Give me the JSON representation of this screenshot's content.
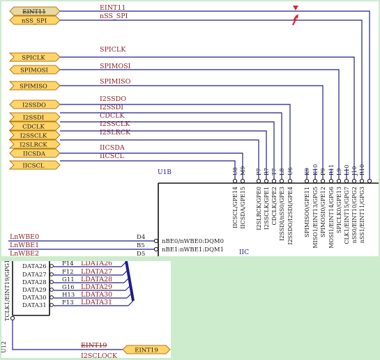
{
  "top_panel": {
    "ports": [
      {
        "label": "EINT11",
        "net": "EINT11",
        "highlighted": true
      },
      {
        "label": "nSS_SPI",
        "net": "nSS_SPI"
      },
      {
        "label": "SPICLK",
        "net": "SPICLK"
      },
      {
        "label": "SPIMOSI",
        "net": "SPIMOSI"
      },
      {
        "label": "SPIMISO",
        "net": "SPIMISO"
      },
      {
        "label": "I2SSDO",
        "net": "I2SSDO"
      },
      {
        "label": "I2SSDI",
        "net": "I2SSDI"
      },
      {
        "label": "CDCLK",
        "net": "CDCLK"
      },
      {
        "label": "I2SSCLK",
        "net": "I2SSCLK"
      },
      {
        "label": "I2SLRCK",
        "net": "I2SLRCK"
      },
      {
        "label": "IICSDA",
        "net": "IICSDA"
      },
      {
        "label": "IICSCL",
        "net": "IICSCL"
      }
    ],
    "pin_numbers": [
      "U8",
      "M9",
      "P7",
      "R7",
      "T7",
      "L8",
      "U6",
      "K9",
      "K10",
      "P9",
      "R11",
      "L9",
      "L10",
      "J10",
      "R10"
    ],
    "pin_names": [
      "IICSCL/GPE14",
      "IICSDA/GPE15",
      "I2SLRCK/GPE0",
      "I2SSCLK/GPE1",
      "CDCLK/GPE2",
      "I2SSDI/nSS0/GPE3",
      "I2SSDO/I2SDI/GPE4",
      "SPIMISO0/GPE11",
      "MISO1/EINT13/GPG5",
      "SPIMOSI0/GPE12",
      "MOSI1/EINT14/GPG6",
      "SPICLK0/GPE13",
      "CLK1/EINT15/GPG7",
      "nSS0/EINT10/GPG2",
      "nSS1/EINT11/GPG3"
    ],
    "chip_ref": "U1B",
    "iic_label": "IIC",
    "left_nets": [
      {
        "net": "LnWBE0",
        "pin": "D4",
        "name": "nBE0/nWBE0:DQM0"
      },
      {
        "net": "LnWBE1",
        "pin": "B5",
        "name": "nBE1:nWBE1:DQM1"
      },
      {
        "net": "LnWBE2",
        "pin": "D5",
        "name": ""
      }
    ]
  },
  "bottom_panel": {
    "rows": [
      {
        "pin_name": "DATA26",
        "pin": "F14",
        "net": "LDATA26"
      },
      {
        "pin_name": "DATA27",
        "pin": "F12",
        "net": "LDATA27"
      },
      {
        "pin_name": "DATA28",
        "pin": "G11",
        "net": "LDATA28"
      },
      {
        "pin_name": "DATA29",
        "pin": "G16",
        "net": "LDATA29"
      },
      {
        "pin_name": "DATA30",
        "pin": "H13",
        "net": "LDATA30"
      },
      {
        "pin_name": "DATA31",
        "pin": "F13",
        "net": "LDATA31"
      }
    ],
    "vertical_pin_name": "TCLK1/EINT19/GPG11",
    "vertical_pin_number": "U12",
    "eint19_net": "EINT19",
    "eint19_port": "EINT19",
    "clip_label": "I2SCLOCK"
  },
  "colors": {
    "background": "#cdeccd",
    "wire": "#1e1e8c",
    "net_label": "#8b1e1e",
    "port_fill": "#ffd46a",
    "marker": "#e8202a"
  }
}
